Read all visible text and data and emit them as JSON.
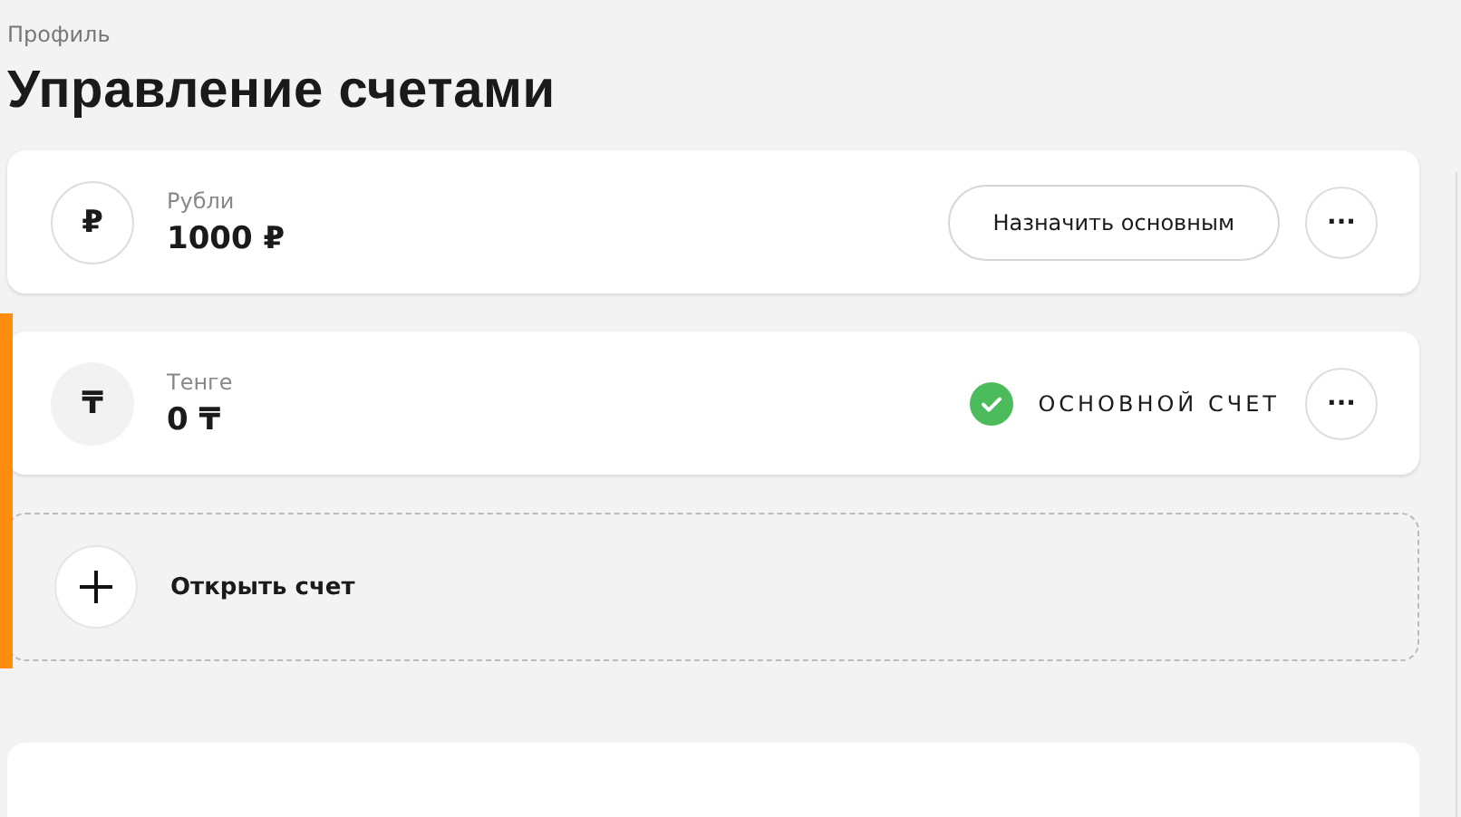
{
  "breadcrumb": "Профиль",
  "title": "Управление счетами",
  "accounts": [
    {
      "currency": "Рубли",
      "balance": "1000 ₽",
      "symbol": "₽",
      "primary": false,
      "action": {
        "kind": "button",
        "label": "Назначить основным"
      },
      "menu": "···"
    },
    {
      "currency": "Тенге",
      "balance": "0 ₸",
      "symbol": "₸",
      "primary": true,
      "action": {
        "kind": "badge",
        "label": "ОСНОВНОЙ СЧЕТ"
      },
      "menu": "···"
    }
  ],
  "open_account": {
    "label": "Открыть счет"
  }
}
